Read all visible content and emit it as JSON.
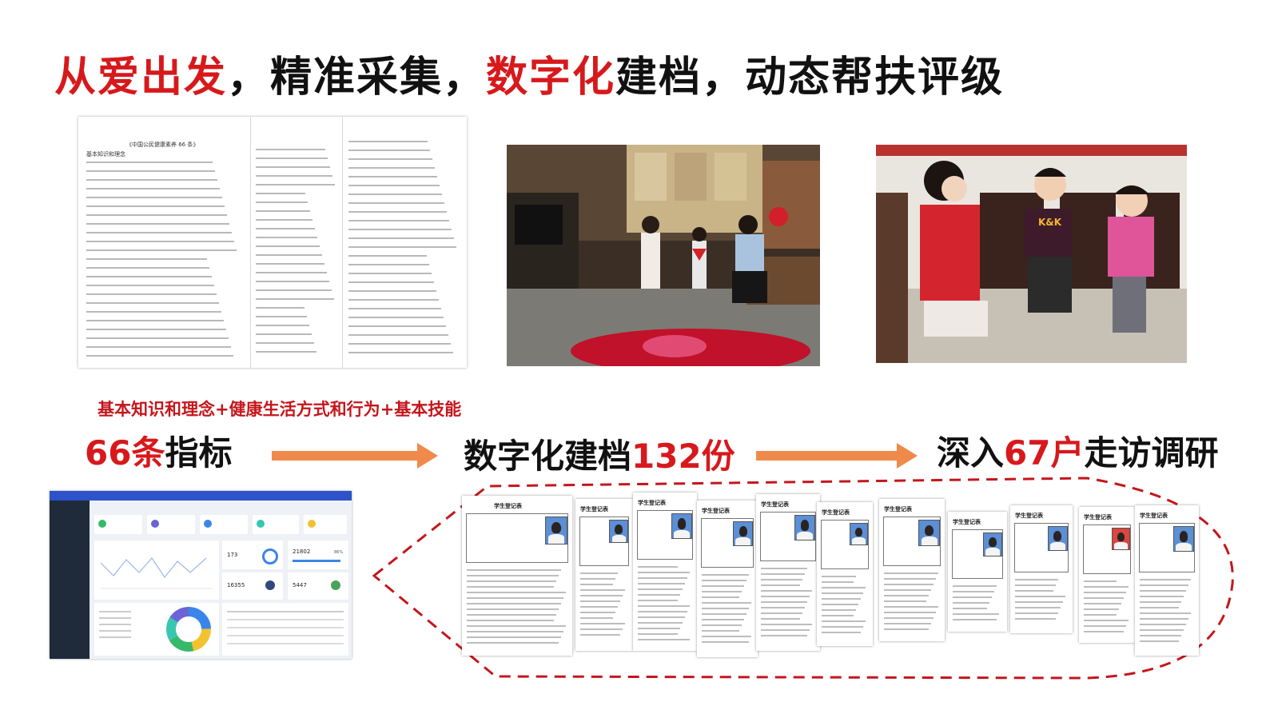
{
  "title": {
    "part1": "从爱出发",
    "part2": "，精准采集，",
    "part3": "数字化",
    "part4": "建档，动态帮扶评级"
  },
  "document": {
    "heading": "《中国公民健康素养 66 条》",
    "section": "基本知识和理念"
  },
  "subtitle": "基本知识和理念+健康生活方式和行为+基本技能",
  "flow": {
    "step1_num": "66条",
    "step1_text": "指标",
    "step2_text": "数字化建档",
    "step2_num": "132份",
    "step3_text_a": "深入",
    "step3_num": "67户",
    "step3_text_b": "走访调研"
  },
  "dashboard": {
    "stats": [
      "173",
      "21802",
      "16355",
      "5447"
    ],
    "percent": "86%"
  },
  "records": {
    "sheet_title": "学生登记表"
  },
  "colors": {
    "accent_red": "#d7191c",
    "arrow_orange": "#f08a4b",
    "dash_blue": "#2d52c9",
    "dashed_outline": "#c4161c"
  }
}
